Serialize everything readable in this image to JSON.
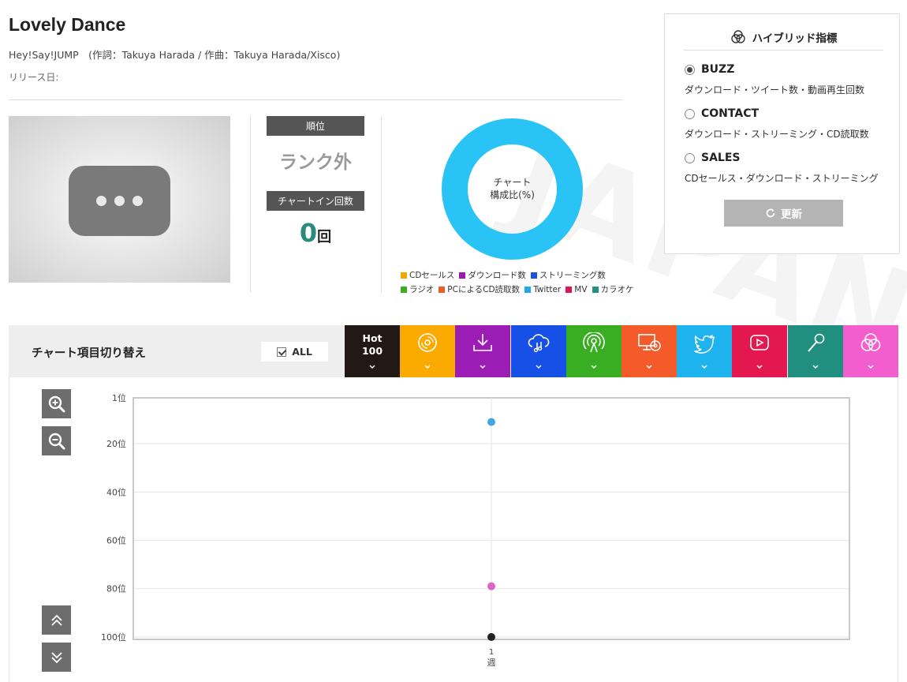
{
  "song": {
    "title": "Lovely Dance",
    "artist_line": "Hey!Say!JUMP　(作詞：Takuya Harada / 作曲：Takuya Harada/Xisco)",
    "release_label": "リリース日:"
  },
  "rank": {
    "rank_label": "順位",
    "rank_value": "ランク外",
    "chartin_label": "チャートイン回数",
    "chartin_count": "0",
    "chartin_unit": "回"
  },
  "composition": {
    "center_line1": "チャート",
    "center_line2": "構成比(%)",
    "ring_color": "#29c3f6",
    "legend": [
      {
        "label": "CDセールス",
        "color": "#f8a500"
      },
      {
        "label": "ダウンロード数",
        "color": "#9b18b5"
      },
      {
        "label": "ストリーミング数",
        "color": "#1653e6"
      },
      {
        "label": "ラジオ",
        "color": "#3cad23"
      },
      {
        "label": "PCによるCD読取数",
        "color": "#f05a28"
      },
      {
        "label": "Twitter",
        "color": "#1ea8e8"
      },
      {
        "label": "MV",
        "color": "#e0144c"
      },
      {
        "label": "カラオケ",
        "color": "#219181"
      }
    ]
  },
  "hybrid": {
    "heading": "ハイブリッド指標",
    "options": [
      {
        "name": "BUZZ",
        "desc": "ダウンロード・ツイート数・動画再生回数",
        "selected": true
      },
      {
        "name": "CONTACT",
        "desc": "ダウンロード・ストリーミング・CD読取数",
        "selected": false
      },
      {
        "name": "SALES",
        "desc": "CDセールス・ダウンロード・ストリーミング",
        "selected": false
      }
    ],
    "refresh_label": "更新"
  },
  "switcher": {
    "title": "チャート項目切り替え",
    "all_label": "ALL",
    "hot_line1": "Hot",
    "hot_line2": "100",
    "categories": [
      {
        "icon": "hot100",
        "color": "#221815"
      },
      {
        "icon": "cd-icon",
        "color": "#fbab00"
      },
      {
        "icon": "download-icon",
        "color": "#9c1cb6"
      },
      {
        "icon": "streaming-icon",
        "color": "#1650e6"
      },
      {
        "icon": "radio-icon",
        "color": "#3aae22"
      },
      {
        "icon": "pc-cd-icon",
        "color": "#f55b2a"
      },
      {
        "icon": "twitter-icon",
        "color": "#1eb2ee"
      },
      {
        "icon": "mv-icon",
        "color": "#e3184e"
      },
      {
        "icon": "karaoke-icon",
        "color": "#218f7f"
      },
      {
        "icon": "hybrid-icon",
        "color": "#f35ecf"
      }
    ]
  },
  "chart_data": {
    "type": "scatter",
    "x_categories": [
      "1週"
    ],
    "x_label_line1": "1",
    "x_label_line2": "週",
    "y_ticks": [
      "1位",
      "20位",
      "40位",
      "60位",
      "80位",
      "100位"
    ],
    "y_tick_values": [
      1,
      20,
      40,
      60,
      80,
      100
    ],
    "ylim": [
      1,
      101
    ],
    "y_inverted": true,
    "grid": true,
    "points": [
      {
        "x": "1週",
        "y": 11,
        "color": "#3ea7e0"
      },
      {
        "x": "1週",
        "y": 79,
        "color": "#dc66c4"
      },
      {
        "x": "1週",
        "y": 101,
        "color": "#222222"
      }
    ]
  }
}
